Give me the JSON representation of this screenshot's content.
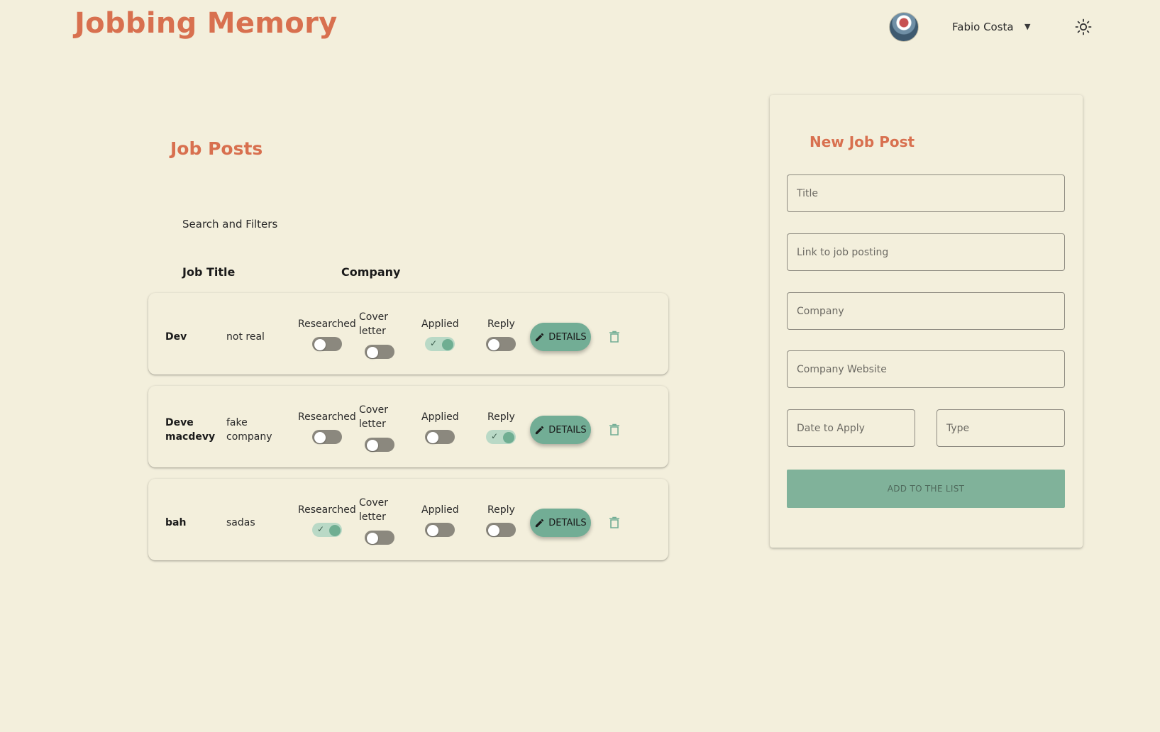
{
  "app": {
    "title": "Jobbing Memory"
  },
  "header": {
    "user_name": "Fabio Costa"
  },
  "job_posts": {
    "section_title": "Job Posts",
    "search_filters_label": "Search and Filters",
    "columns": {
      "job_title": "Job Title",
      "company": "Company"
    },
    "toggle_labels": {
      "researched": "Researched",
      "cover_letter_line1": "Cover",
      "cover_letter_line2": "letter",
      "applied": "Applied",
      "reply": "Reply"
    },
    "details_label": "DETAILS",
    "rows": [
      {
        "title": "Dev",
        "company": "not real",
        "researched": false,
        "cover_letter": false,
        "applied": true,
        "reply": false
      },
      {
        "title_line1": "Deve",
        "title_line2": "macdevy",
        "company_line1": "fake",
        "company_line2": "company",
        "researched": false,
        "cover_letter": false,
        "applied": false,
        "reply": true
      },
      {
        "title": "bah",
        "company": "sadas",
        "researched": true,
        "cover_letter": false,
        "applied": false,
        "reply": false
      }
    ]
  },
  "new_job_post": {
    "title": "New Job Post",
    "fields": {
      "title_placeholder": "Title",
      "link_placeholder": "Link to job posting",
      "company_placeholder": "Company",
      "company_website_placeholder": "Company Website",
      "date_placeholder": "Date to Apply",
      "type_placeholder": "Type"
    },
    "submit_label": "ADD TO THE LIST"
  },
  "colors": {
    "accent": "#d8704f",
    "background": "#f3efdc",
    "primary_green": "#72ad95",
    "switch_off": "#8b887e",
    "switch_on_track": "#b9d9c6"
  },
  "icons": {
    "theme_toggle": "sun-icon",
    "edit": "pencil-icon",
    "delete": "trash-icon",
    "menu": "caret-down-icon"
  }
}
